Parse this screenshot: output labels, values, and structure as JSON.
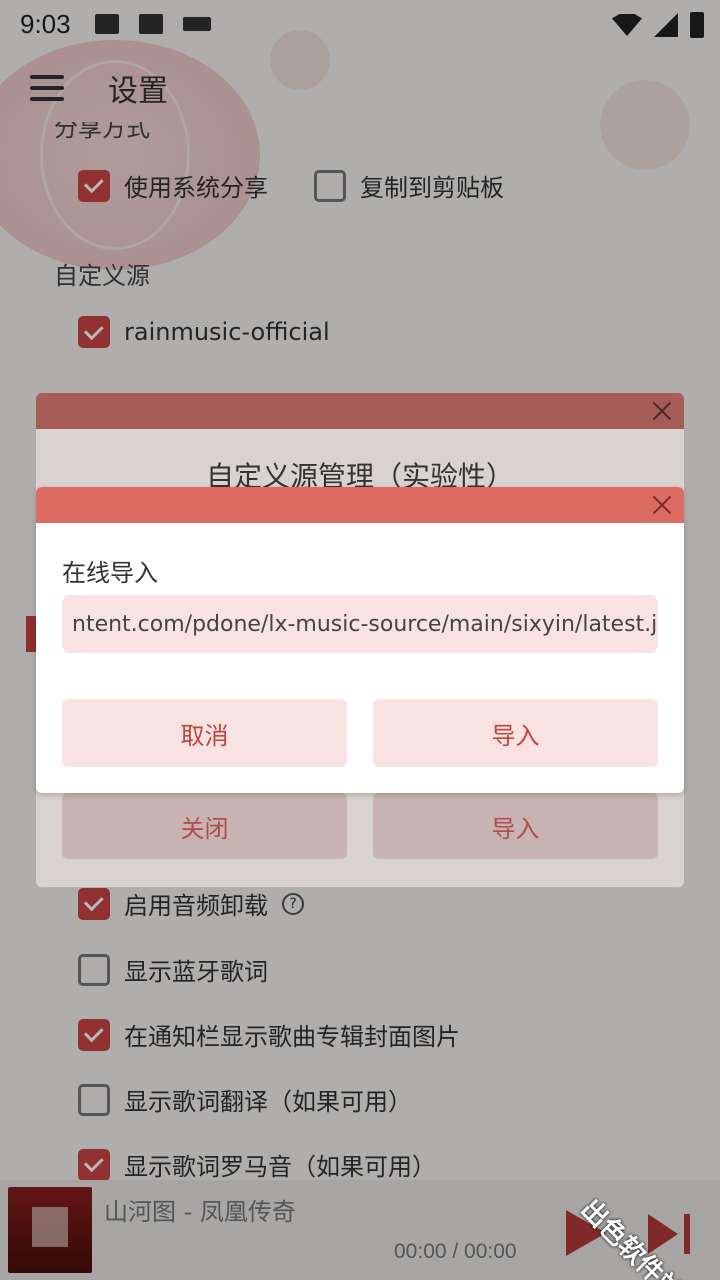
{
  "status": {
    "time": "9:03"
  },
  "header": {
    "title": "设置"
  },
  "settings": {
    "share_section": "分享方式",
    "share_system": "使用系统分享",
    "share_clipboard": "复制到剪贴板",
    "custom_source_section": "自定义源",
    "source_item": "rainmusic-official",
    "audio_offload": "启用音频卸载",
    "bluetooth_lyric": "显示蓝牙歌词",
    "notification_cover": "在通知栏显示歌曲专辑封面图片",
    "lyric_translation": "显示歌词翻译（如果可用）",
    "lyric_roma": "显示歌词罗马音（如果可用）"
  },
  "dialog_manage": {
    "title": "自定义源管理（实验性）",
    "close_label": "关闭",
    "import_label": "导入"
  },
  "dialog_import": {
    "label": "在线导入",
    "url_value": "ntent.com/pdone/lx-music-source/main/sixyin/latest.js",
    "cancel_label": "取消",
    "import_label": "导入"
  },
  "player": {
    "song": "山河图 - 凤凰传奇",
    "time": "00:00 / 00:00"
  },
  "watermark": "出色软件站",
  "colors": {
    "accent": "#c94545",
    "dialog_bar": "#dc6b62"
  },
  "icons": [
    "menu-icon",
    "close-icon",
    "help-icon",
    "play-icon",
    "next-icon",
    "wifi-icon",
    "signal-icon",
    "battery-icon"
  ]
}
